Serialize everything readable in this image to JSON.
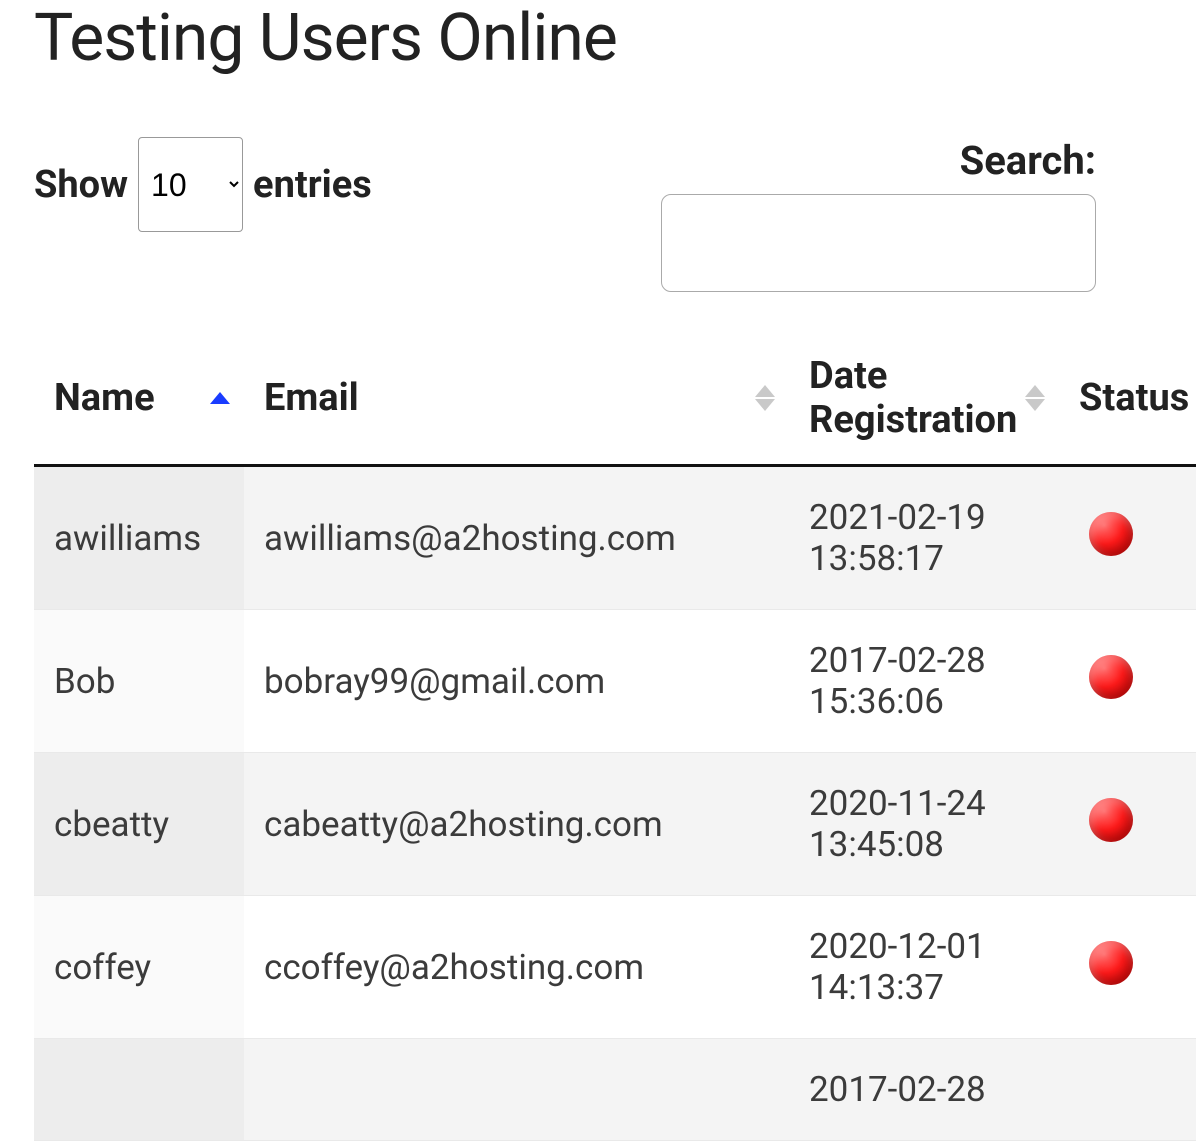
{
  "page": {
    "title": "Testing Users Online"
  },
  "length": {
    "show_label": "Show",
    "entries_label": "entries",
    "selected": "10"
  },
  "search": {
    "label": "Search:",
    "value": ""
  },
  "columns": {
    "name": "Name",
    "email": "Email",
    "date": "Date Registration",
    "status": "Status"
  },
  "sort": {
    "column": "name",
    "direction": "asc"
  },
  "status_colors": {
    "offline": "#ff1a1a"
  },
  "rows": [
    {
      "name": "awilliams",
      "email": "awilliams@a2hosting.com",
      "date": "2021-02-19 13:58:17",
      "status": "offline"
    },
    {
      "name": "Bob",
      "email": "bobray99@gmail.com",
      "date": "2017-02-28 15:36:06",
      "status": "offline"
    },
    {
      "name": "cbeatty",
      "email": "cabeatty@a2hosting.com",
      "date": "2020-11-24 13:45:08",
      "status": "offline"
    },
    {
      "name": "coffey",
      "email": "ccoffey@a2hosting.com",
      "date": "2020-12-01 14:13:37",
      "status": "offline"
    },
    {
      "name": "",
      "email": "",
      "date": "2017-02-28",
      "status": ""
    }
  ]
}
